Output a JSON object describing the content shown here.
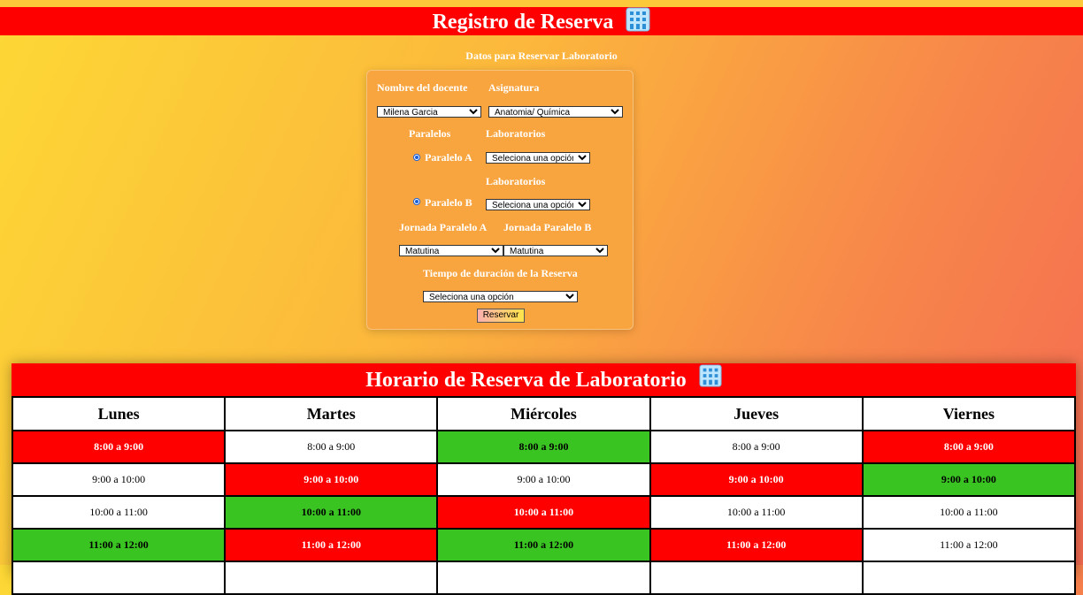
{
  "header": {
    "title": "Registro de Reserva"
  },
  "form": {
    "heading": "Datos para Reservar Laboratorio",
    "docente_label": "Nombre del docente",
    "docente_value": "Milena Garcia",
    "asignatura_label": "Asignatura",
    "asignatura_value": "Anatomia/ Química",
    "paralelos_label": "Paralelos",
    "laboratorios_label": "Laboratorios",
    "paralelo_a": "Paralelo A",
    "lab_a_value": "Seleciona una opción",
    "laboratorios_label_2": "Laboratorios",
    "paralelo_b": "Paralelo B",
    "lab_b_value": "Seleciona una opción",
    "jornada_a_label": "Jornada Paralelo A",
    "jornada_b_label": "Jornada Paralelo B",
    "jornada_a_value": "Matutina",
    "jornada_b_value": "Matutina",
    "tiempo_label": "Tiempo de duración de la Reserva",
    "tiempo_value": "Seleciona una opción",
    "submit_label": "Reservar"
  },
  "schedule": {
    "title": "Horario de Reserva de Laboratorio",
    "days": [
      "Lunes",
      "Martes",
      "Miércoles",
      "Jueves",
      "Viernes"
    ],
    "rows": [
      [
        "8:00 a 9:00",
        "8:00 a 9:00",
        "8:00 a 9:00",
        "8:00 a 9:00",
        "8:00 a 9:00"
      ],
      [
        "9:00 a 10:00",
        "9:00 a 10:00",
        "9:00 a 10:00",
        "9:00 a 10:00",
        "9:00 a 10:00"
      ],
      [
        "10:00 a 11:00",
        "10:00 a 11:00",
        "10:00 a 11:00",
        "10:00 a 11:00",
        "10:00 a 11:00"
      ],
      [
        "11:00 a 12:00",
        "11:00 a 12:00",
        "11:00 a 12:00",
        "11:00 a 12:00",
        "11:00 a 12:00"
      ],
      [
        "",
        "",
        "",
        "",
        ""
      ]
    ],
    "status": [
      [
        "r",
        "w",
        "g",
        "w",
        "r"
      ],
      [
        "w",
        "r",
        "w",
        "r",
        "g"
      ],
      [
        "w",
        "g",
        "r",
        "w",
        "w"
      ],
      [
        "g",
        "r",
        "g",
        "r",
        "w"
      ],
      [
        "w",
        "w",
        "w",
        "w",
        "w"
      ]
    ]
  },
  "colors": {
    "reserved": "#ff0000",
    "available": "#3ac422",
    "free": "#ffffff",
    "header": "#ff0000"
  },
  "icons": {
    "title_icon": "office-building-icon"
  }
}
